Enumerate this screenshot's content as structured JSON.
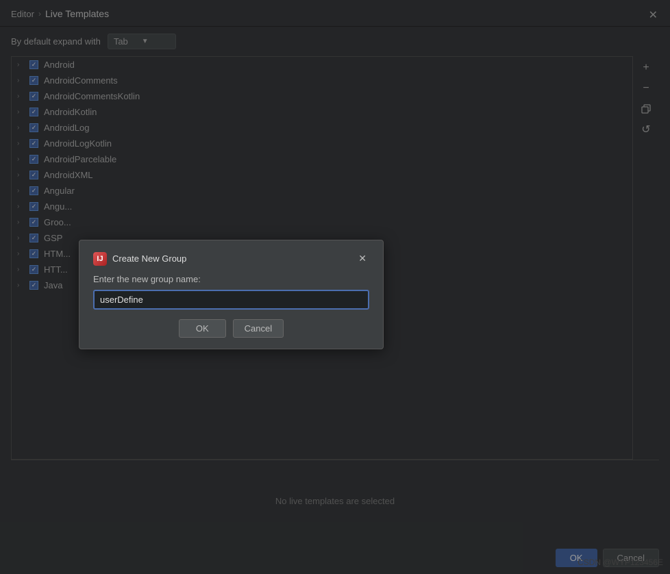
{
  "breadcrumb": {
    "parent": "Editor",
    "separator": "›",
    "current": "Live Templates"
  },
  "toolbar": {
    "expand_label": "By default expand with",
    "dropdown_value": "Tab"
  },
  "close_button": "✕",
  "list_items": [
    {
      "label": "Android",
      "checked": true
    },
    {
      "label": "AndroidComments",
      "checked": true
    },
    {
      "label": "AndroidCommentsKotlin",
      "checked": true
    },
    {
      "label": "AndroidKotlin",
      "checked": true
    },
    {
      "label": "AndroidLog",
      "checked": true
    },
    {
      "label": "AndroidLogKotlin",
      "checked": true
    },
    {
      "label": "AndroidParcelable",
      "checked": true
    },
    {
      "label": "AndroidXML",
      "checked": true
    },
    {
      "label": "Angular",
      "checked": true
    },
    {
      "label": "Angu...",
      "checked": true
    },
    {
      "label": "Groo...",
      "checked": true
    },
    {
      "label": "GSP",
      "checked": true
    },
    {
      "label": "HTM...",
      "checked": true
    },
    {
      "label": "HTT...",
      "checked": true
    },
    {
      "label": "Java",
      "checked": true
    }
  ],
  "side_buttons": {
    "add": "+",
    "remove": "−",
    "copy": "⧉",
    "reset": "↺"
  },
  "status_text": "No live templates are selected",
  "bottom_buttons": {
    "ok": "OK",
    "cancel": "Cancel"
  },
  "modal": {
    "title": "Create New Group",
    "icon_label": "IJ",
    "label": "Enter the new group name:",
    "input_value": "userDefine",
    "input_placeholder": "",
    "ok_label": "OK",
    "cancel_label": "Cancel"
  },
  "watermark": "CSDN @WYP123456E"
}
